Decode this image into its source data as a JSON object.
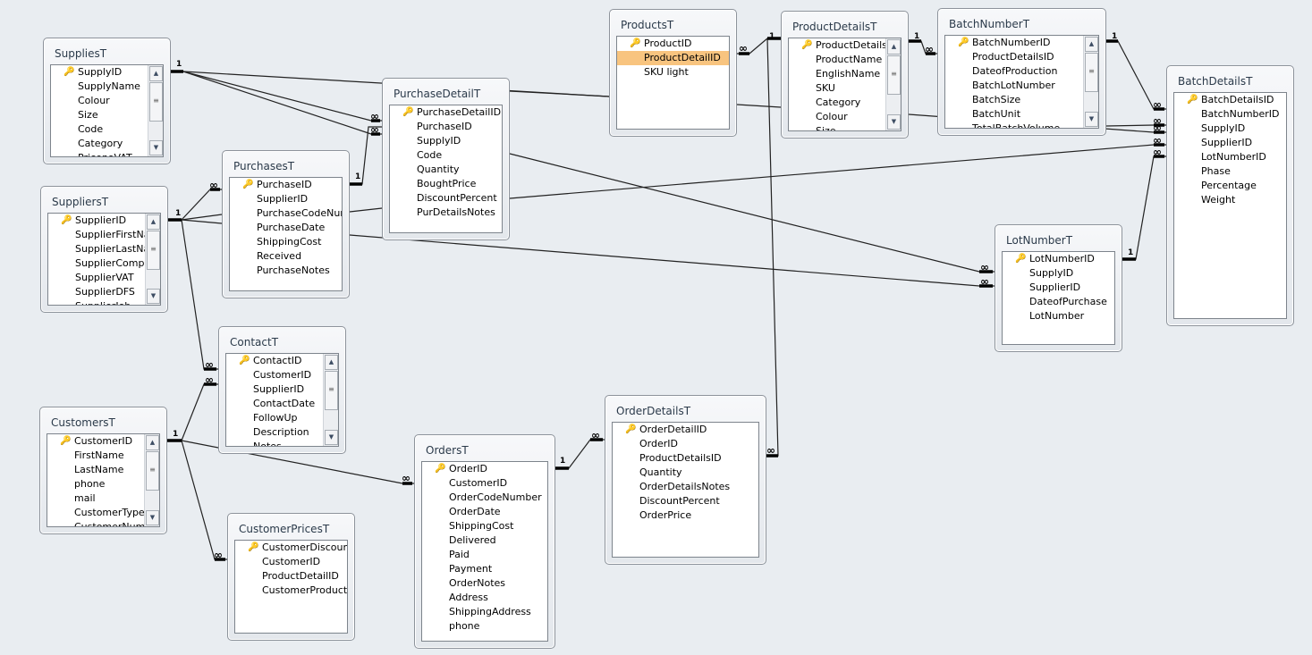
{
  "tables": [
    {
      "name": "SuppliesT",
      "scroll": true,
      "fields": [
        "SupplyID",
        "SupplyName",
        "Colour",
        "Size",
        "Code",
        "Category",
        "PricenoVAT"
      ]
    },
    {
      "name": "SuppliersT",
      "scroll": true,
      "fields": [
        "SupplierID",
        "SupplierFirstName",
        "SupplierLastName",
        "SupplierCompany",
        "SupplierVAT",
        "SupplierDFS",
        "SupplierJob"
      ]
    },
    {
      "name": "PurchasesT",
      "scroll": false,
      "fields": [
        "PurchaseID",
        "SupplierID",
        "PurchaseCodeNumber",
        "PurchaseDate",
        "ShippingCost",
        "Received",
        "PurchaseNotes"
      ]
    },
    {
      "name": "PurchaseDetailT",
      "scroll": false,
      "fields": [
        "PurchaseDetailID",
        "PurchaseID",
        "SupplyID",
        "Code",
        "Quantity",
        "BoughtPrice",
        "DiscountPercent",
        "PurDetailsNotes"
      ]
    },
    {
      "name": "ProductsT",
      "scroll": false,
      "selected": 1,
      "fields": [
        "ProductID",
        "ProductDetailID",
        "SKU light"
      ]
    },
    {
      "name": "ProductDetailsT",
      "scroll": true,
      "fields": [
        "ProductDetailsID",
        "ProductName",
        "EnglishName",
        "SKU",
        "Category",
        "Colour",
        "Size"
      ]
    },
    {
      "name": "BatchNumberT",
      "scroll": true,
      "fields": [
        "BatchNumberID",
        "ProductDetailsID",
        "DateofProduction",
        "BatchLotNumber",
        "BatchSize",
        "BatchUnit",
        "TotalBatchVolume"
      ]
    },
    {
      "name": "BatchDetailsT",
      "scroll": false,
      "fields": [
        "BatchDetailsID",
        "BatchNumberID",
        "SupplyID",
        "SupplierID",
        "LotNumberID",
        "Phase",
        "Percentage",
        "Weight"
      ]
    },
    {
      "name": "LotNumberT",
      "scroll": false,
      "fields": [
        "LotNumberID",
        "SupplyID",
        "SupplierID",
        "DateofPurchase",
        "LotNumber"
      ]
    },
    {
      "name": "ContactT",
      "scroll": true,
      "fields": [
        "ContactID",
        "CustomerID",
        "SupplierID",
        "ContactDate",
        "FollowUp",
        "Description",
        "Notes"
      ]
    },
    {
      "name": "CustomersT",
      "scroll": true,
      "fields": [
        "CustomerID",
        "FirstName",
        "LastName",
        "phone",
        "mail",
        "CustomerType",
        "CustomerNumber"
      ]
    },
    {
      "name": "CustomerPricesT",
      "scroll": false,
      "fields": [
        "CustomerDiscountsID",
        "CustomerID",
        "ProductDetailID",
        "CustomerProductDiscount"
      ]
    },
    {
      "name": "OrdersT",
      "scroll": false,
      "fields": [
        "OrderID",
        "CustomerID",
        "OrderCodeNumber",
        "OrderDate",
        "ShippingCost",
        "Delivered",
        "Paid",
        "Payment",
        "OrderNotes",
        "Address",
        "ShippingAddress",
        "phone"
      ]
    },
    {
      "name": "OrderDetailsT",
      "scroll": false,
      "fields": [
        "OrderDetailID",
        "OrderID",
        "ProductDetailsID",
        "Quantity",
        "OrderDetailsNotes",
        "DiscountPercent",
        "OrderPrice"
      ]
    }
  ],
  "cardinality": {
    "one": "1",
    "many": "∞"
  },
  "colors": {
    "selected_row": "#f8c47f",
    "background": "#e9edf1"
  }
}
